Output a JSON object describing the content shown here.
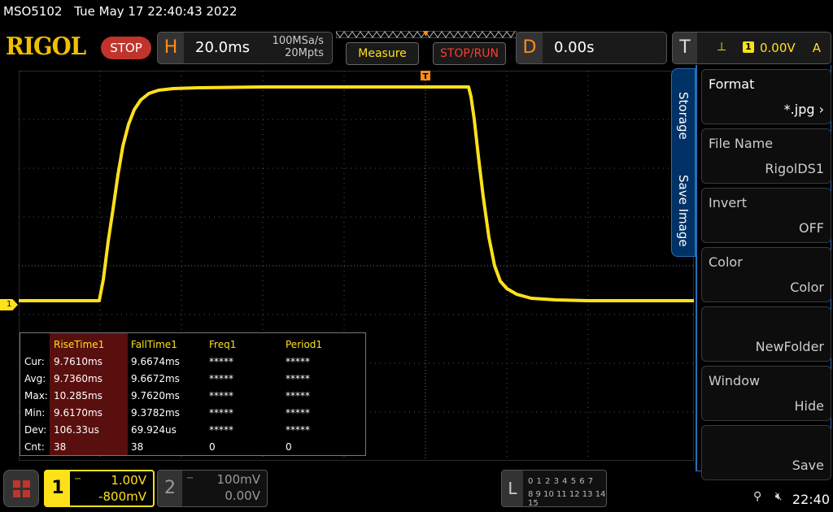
{
  "title": {
    "model": "MSO5102",
    "datetime": "Tue May 17 22:40:43 2022"
  },
  "top": {
    "brand": "RIGOL",
    "run_state": "STOP",
    "horizontal": {
      "letter": "H",
      "timebase": "20.0ms",
      "sample_rate": "100MSa/s",
      "memory_depth": "20Mpts"
    },
    "measure_label": "Measure",
    "stoprun_label": "STOP/RUN",
    "delay": {
      "letter": "D",
      "value": "0.00s"
    },
    "trigger": {
      "letter": "T",
      "source": "1",
      "level": "0.00V",
      "mode": "A"
    }
  },
  "trigger_marker": "T",
  "channel_marker": "1",
  "measurements": {
    "columns": [
      "RiseTime1",
      "FallTime1",
      "Freq1",
      "Period1"
    ],
    "rows": [
      {
        "label": "Cur:",
        "values": [
          "9.7610ms",
          "9.6674ms",
          "*****",
          "*****"
        ]
      },
      {
        "label": "Avg:",
        "values": [
          "9.7360ms",
          "9.6672ms",
          "*****",
          "*****"
        ]
      },
      {
        "label": "Max:",
        "values": [
          "10.285ms",
          "9.7620ms",
          "*****",
          "*****"
        ]
      },
      {
        "label": "Min:",
        "values": [
          "9.6170ms",
          "9.3782ms",
          "*****",
          "*****"
        ]
      },
      {
        "label": "Dev:",
        "values": [
          "106.33us",
          "69.924us",
          "*****",
          "*****"
        ]
      },
      {
        "label": "Cnt:",
        "values": [
          "38",
          "38",
          "0",
          "0"
        ]
      }
    ]
  },
  "sidebar": {
    "tabs": [
      "Storage",
      "Save Image"
    ],
    "items": [
      {
        "key": "Format",
        "value": "*.jpg",
        "state": "active"
      },
      {
        "key": "File Name",
        "value": "RigolDS1",
        "state": "normal"
      },
      {
        "key": "Invert",
        "value": "OFF",
        "state": "normal"
      },
      {
        "key": "Color",
        "value": "Color",
        "state": "normal"
      },
      {
        "key": "",
        "value": "NewFolder",
        "state": "normal"
      },
      {
        "key": "Window",
        "value": "Hide",
        "state": "normal"
      },
      {
        "key": "",
        "value": "Save",
        "state": "normal"
      }
    ]
  },
  "bottom": {
    "ch1": {
      "number": "1",
      "scale": "1.00V",
      "offset": "-800mV"
    },
    "ch2": {
      "number": "2",
      "scale": "100mV",
      "offset": "0.00V"
    },
    "la": {
      "letter": "L",
      "row1": "0 1 2 3  4 5 6 7",
      "row2": "8 9 10 11 12 13 14 15"
    },
    "time": "22:40"
  },
  "colors": {
    "trace": "#ffe11a",
    "accent": "#ff8c1a",
    "menu_border": "#2a6fb8",
    "stop": "#c0342c"
  }
}
